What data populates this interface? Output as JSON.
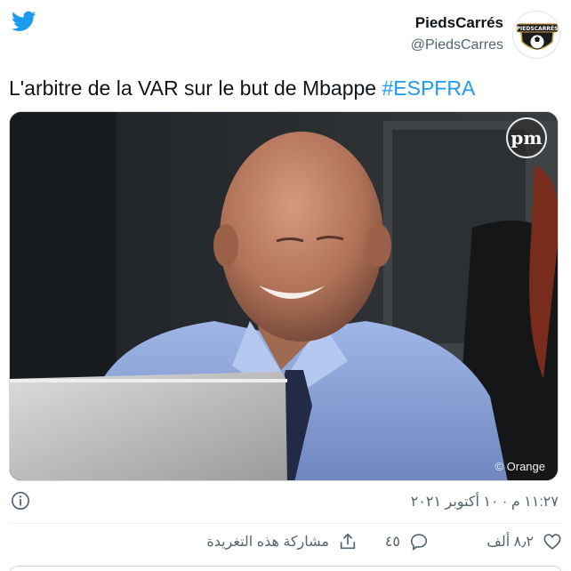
{
  "account": {
    "display_name": "PiedsCarrés",
    "handle": "@PiedsCarres",
    "avatar_text": "PIEDSCARRÉS"
  },
  "tweet": {
    "text": "L'arbitre de la VAR sur le but de Mbappe ",
    "hashtag": "#ESPFRA"
  },
  "media": {
    "badge": "pm",
    "watermark": "© Orange"
  },
  "meta": {
    "timestamp": "١١:٢٧ م · ١٠ أكتوبر ٢٠٢١"
  },
  "actions": {
    "likes": "٨٫٢ ألف",
    "replies": "٤٥",
    "share_label": "مشاركة هذه التغريدة"
  },
  "icons": {
    "logo": "twitter-bird-icon",
    "info": "info-icon",
    "like": "heart-icon",
    "reply": "reply-bubble-icon",
    "share": "share-icon"
  },
  "colors": {
    "brand": "#1d9bf0",
    "text": "#0f1419",
    "secondary": "#536471"
  }
}
